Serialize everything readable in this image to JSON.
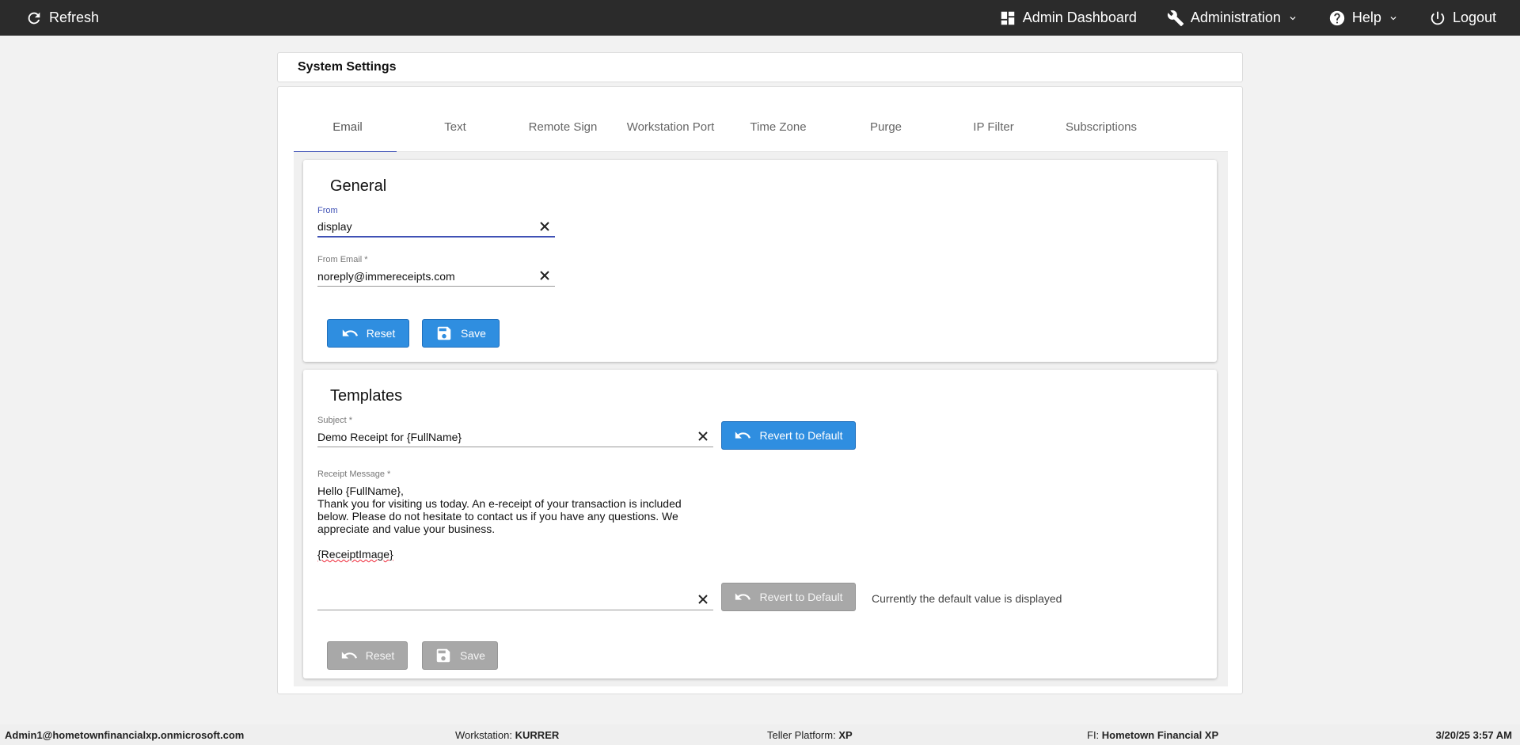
{
  "topbar": {
    "refresh": "Refresh",
    "admin_dashboard": "Admin Dashboard",
    "administration": "Administration",
    "help": "Help",
    "logout": "Logout"
  },
  "header": {
    "title": "System Settings"
  },
  "tabs": [
    "Email",
    "Text",
    "Remote Sign",
    "Workstation Port",
    "Time Zone",
    "Purge",
    "IP Filter",
    "Subscriptions"
  ],
  "general": {
    "title": "General",
    "from_label": "From",
    "from_value": "display",
    "from_email_label": "From Email *",
    "from_email_value": "noreply@immereceipts.com",
    "reset": "Reset",
    "save": "Save"
  },
  "templates": {
    "title": "Templates",
    "subject_label": "Subject *",
    "subject_value": "Demo Receipt for {FullName}",
    "revert": "Revert to Default",
    "receipt_label": "Receipt Message *",
    "receipt_line1": "Hello {FullName},",
    "receipt_line2": "Thank you for visiting us today. An e-receipt of your transaction is included below. Please do not hesitate to contact us if you have any questions. We appreciate and value your business.",
    "receipt_line3": "{ReceiptImage}",
    "revert2": "Revert to Default",
    "default_note": "Currently the default value is displayed",
    "reset": "Reset",
    "save": "Save"
  },
  "footer": {
    "user": "Admin1@hometownfinancialxp.onmicrosoft.com",
    "workstation_label": "Workstation:",
    "workstation_value": "KURRER",
    "platform_label": "Teller Platform:",
    "platform_value": "XP",
    "fi_label": "FI:",
    "fi_value": "Hometown Financial XP",
    "datetime": "3/20/25 3:57 AM"
  },
  "colors": {
    "accent": "#3f51b5",
    "button_blue": "#2f8ee0",
    "topbar": "#2b2b2b"
  }
}
